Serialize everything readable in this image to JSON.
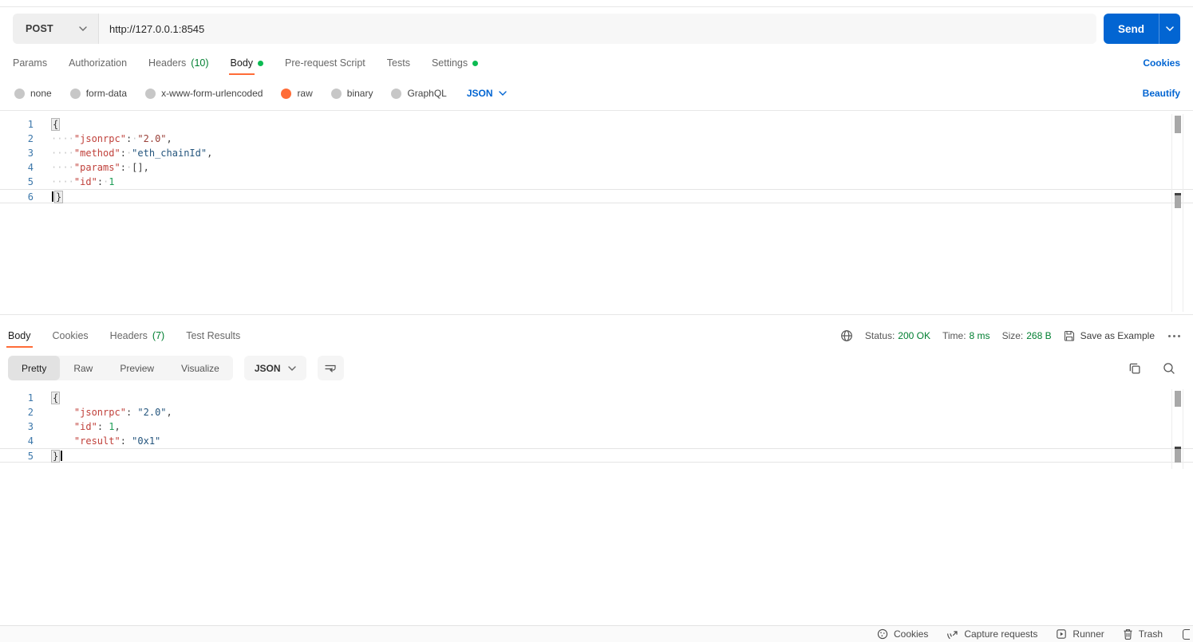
{
  "colors": {
    "accent_blue": "#0265d2",
    "accent_orange": "#ff6c37",
    "green_dot": "#0cbb52",
    "green_text": "#007f31",
    "code_key": "#c0413b",
    "code_string": "#24557d",
    "code_string_warm": "#9a4038",
    "code_number": "#1e9e57",
    "code_punct": "#3d3d3d",
    "gutter_number": "#3c77aa",
    "whitespace_dot": "#c9c9c9"
  },
  "request_bar": {
    "method": "POST",
    "url": "http://127.0.0.1:8545",
    "send_label": "Send"
  },
  "request_tabs": {
    "items": [
      {
        "name": "params",
        "label": "Params"
      },
      {
        "name": "authorization",
        "label": "Authorization"
      },
      {
        "name": "headers",
        "label": "Headers",
        "count": "(10)"
      },
      {
        "name": "body",
        "label": "Body",
        "active": true,
        "dot": true
      },
      {
        "name": "pre-request-script",
        "label": "Pre-request Script"
      },
      {
        "name": "tests",
        "label": "Tests"
      },
      {
        "name": "settings",
        "label": "Settings",
        "dot": true
      }
    ],
    "cookies_link": "Cookies"
  },
  "body_type": {
    "options": [
      {
        "name": "none",
        "label": "none"
      },
      {
        "name": "form-data",
        "label": "form-data"
      },
      {
        "name": "x-www-form-urlencoded",
        "label": "x-www-form-urlencoded"
      },
      {
        "name": "raw",
        "label": "raw",
        "selected": true
      },
      {
        "name": "binary",
        "label": "binary"
      },
      {
        "name": "graphql",
        "label": "GraphQL"
      }
    ],
    "language": "JSON",
    "beautify_link": "Beautify"
  },
  "request_editor": {
    "lines": [
      {
        "n": 1,
        "tokens": [
          {
            "c": "brace-box",
            "t": "{"
          }
        ]
      },
      {
        "n": 2,
        "tokens": [
          {
            "c": "ws",
            "t": "····"
          },
          {
            "c": "key",
            "t": "\"jsonrpc\""
          },
          {
            "c": "pun",
            "t": ":"
          },
          {
            "c": "ws",
            "t": "·"
          },
          {
            "c": "strw",
            "t": "\"2.0\""
          },
          {
            "c": "pun",
            "t": ","
          }
        ]
      },
      {
        "n": 3,
        "tokens": [
          {
            "c": "ws",
            "t": "····"
          },
          {
            "c": "key",
            "t": "\"method\""
          },
          {
            "c": "pun",
            "t": ":"
          },
          {
            "c": "ws",
            "t": "·"
          },
          {
            "c": "str",
            "t": "\"eth_chainId\""
          },
          {
            "c": "pun",
            "t": ","
          }
        ]
      },
      {
        "n": 4,
        "tokens": [
          {
            "c": "ws",
            "t": "····"
          },
          {
            "c": "key",
            "t": "\"params\""
          },
          {
            "c": "pun",
            "t": ":"
          },
          {
            "c": "ws",
            "t": "·"
          },
          {
            "c": "pun",
            "t": "[],"
          }
        ]
      },
      {
        "n": 5,
        "tokens": [
          {
            "c": "ws",
            "t": "····"
          },
          {
            "c": "key",
            "t": "\"id\""
          },
          {
            "c": "pun",
            "t": ":"
          },
          {
            "c": "ws",
            "t": "·"
          },
          {
            "c": "num",
            "t": "1"
          }
        ]
      },
      {
        "n": 6,
        "active": true,
        "tokens": [
          {
            "c": "cursor"
          },
          {
            "c": "brace-box",
            "t": "}"
          }
        ]
      }
    ]
  },
  "response": {
    "tabs": [
      {
        "name": "body",
        "label": "Body",
        "active": true
      },
      {
        "name": "cookies",
        "label": "Cookies"
      },
      {
        "name": "headers",
        "label": "Headers",
        "count": "(7)"
      },
      {
        "name": "test-results",
        "label": "Test Results"
      }
    ],
    "meta": {
      "status_label": "Status:",
      "status_value": "200 OK",
      "time_label": "Time:",
      "time_value": "8 ms",
      "size_label": "Size:",
      "size_value": "268 B",
      "save_as_example": "Save as Example"
    },
    "view_tabs": [
      {
        "name": "pretty",
        "label": "Pretty",
        "active": true
      },
      {
        "name": "raw",
        "label": "Raw"
      },
      {
        "name": "preview",
        "label": "Preview"
      },
      {
        "name": "visualize",
        "label": "Visualize"
      }
    ],
    "language": "JSON",
    "editor": {
      "lines": [
        {
          "n": 1,
          "tokens": [
            {
              "c": "brace-box",
              "t": "{"
            }
          ]
        },
        {
          "n": 2,
          "tokens": [
            {
              "c": "pun",
              "t": "    "
            },
            {
              "c": "key",
              "t": "\"jsonrpc\""
            },
            {
              "c": "pun",
              "t": ": "
            },
            {
              "c": "str",
              "t": "\"2.0\""
            },
            {
              "c": "pun",
              "t": ","
            }
          ]
        },
        {
          "n": 3,
          "tokens": [
            {
              "c": "pun",
              "t": "    "
            },
            {
              "c": "key",
              "t": "\"id\""
            },
            {
              "c": "pun",
              "t": ": "
            },
            {
              "c": "num",
              "t": "1"
            },
            {
              "c": "pun",
              "t": ","
            }
          ]
        },
        {
          "n": 4,
          "tokens": [
            {
              "c": "pun",
              "t": "    "
            },
            {
              "c": "key",
              "t": "\"result\""
            },
            {
              "c": "pun",
              "t": ": "
            },
            {
              "c": "str",
              "t": "\"0x1\""
            }
          ]
        },
        {
          "n": 5,
          "active": true,
          "tokens": [
            {
              "c": "brace-box",
              "t": "}"
            },
            {
              "c": "cursor"
            }
          ]
        }
      ]
    }
  },
  "footer": {
    "items": [
      {
        "name": "cookies",
        "label": "Cookies"
      },
      {
        "name": "capture-requests",
        "label": "Capture requests"
      },
      {
        "name": "runner",
        "label": "Runner"
      },
      {
        "name": "trash",
        "label": "Trash"
      }
    ]
  }
}
